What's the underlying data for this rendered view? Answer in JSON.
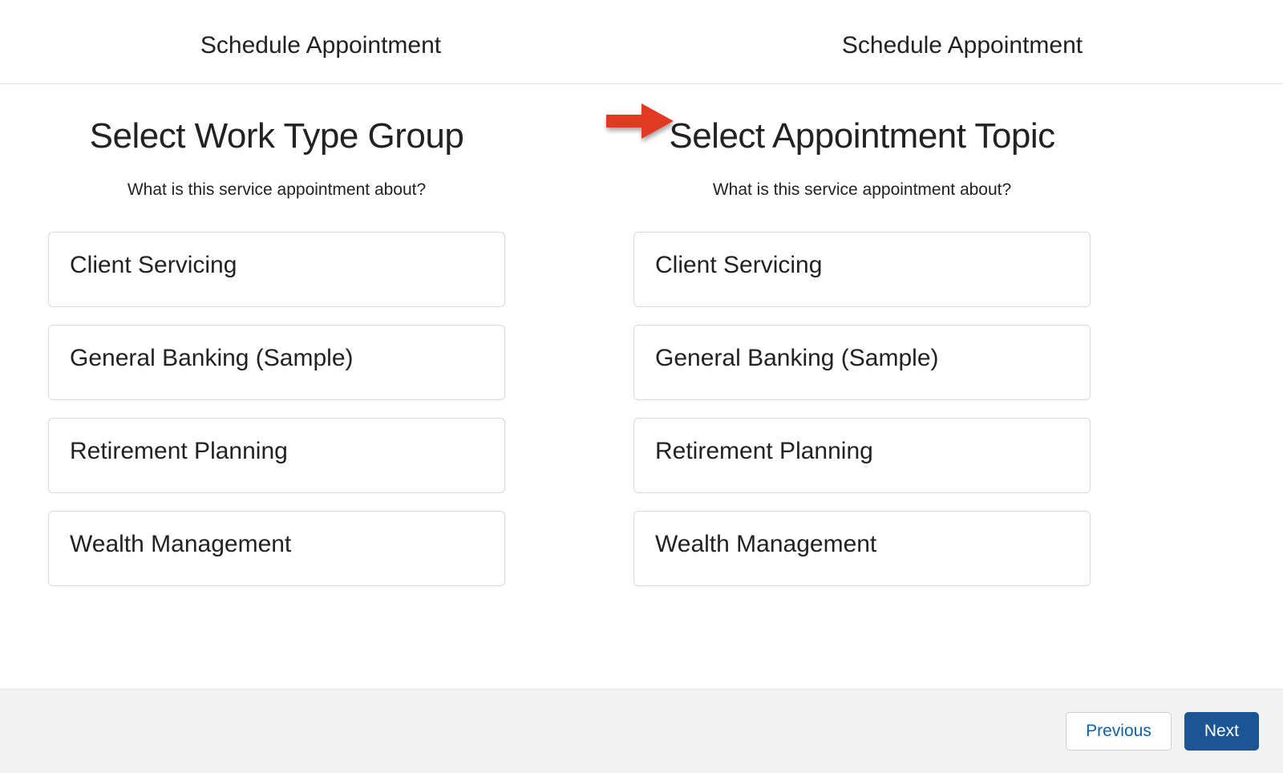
{
  "header": {
    "left_title": "Schedule Appointment",
    "right_title": "Schedule Appointment"
  },
  "left_panel": {
    "title": "Select Work Type Group",
    "subtitle": "What is this service appointment about?",
    "options": [
      "Client Servicing",
      "General Banking (Sample)",
      "Retirement Planning",
      "Wealth Management"
    ]
  },
  "right_panel": {
    "title": "Select Appointment Topic",
    "subtitle": "What is this service appointment about?",
    "options": [
      "Client Servicing",
      "General Banking (Sample)",
      "Retirement Planning",
      "Wealth Management"
    ]
  },
  "footer": {
    "previous_label": "Previous",
    "next_label": "Next"
  }
}
